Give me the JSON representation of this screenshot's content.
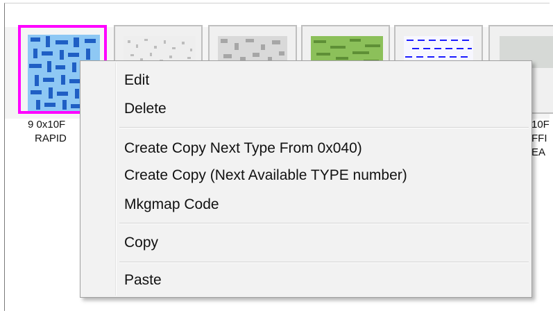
{
  "tiles": [
    {
      "label_line1": "9 0x10F",
      "label_line2": "RAPID"
    },
    {
      "label_line1": "",
      "label_line2": ""
    },
    {
      "label_line1": "",
      "label_line2": ""
    },
    {
      "label_line1": "",
      "label_line2": ""
    },
    {
      "label_line1": "",
      "label_line2": ""
    },
    {
      "label_line1": "10F",
      "label_line2": "FFI",
      "label_line3": "EA"
    }
  ],
  "context_menu": {
    "items": [
      {
        "label": "Edit"
      },
      {
        "label": "Delete"
      },
      {
        "label": "Create Copy Next Type From 0x040)"
      },
      {
        "label": "Create Copy (Next Available TYPE number)"
      },
      {
        "label": "Mkgmap Code"
      },
      {
        "label": "Copy"
      },
      {
        "label": "Paste"
      }
    ]
  },
  "colors": {
    "selection_border": "#ff00ff",
    "pattern_blue": "#1f6fd6",
    "pattern_green": "#6a9a3a",
    "dash_blue": "#1a1aff"
  }
}
